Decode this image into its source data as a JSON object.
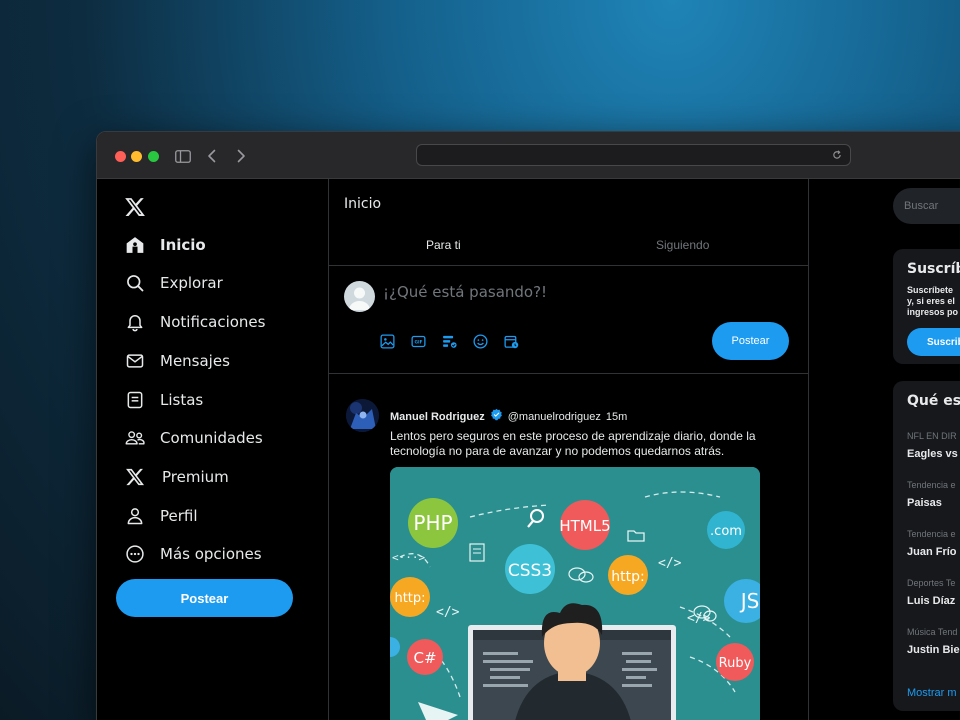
{
  "sidebar": {
    "items": [
      {
        "label": "Inicio",
        "icon": "home-icon"
      },
      {
        "label": "Explorar",
        "icon": "search-icon"
      },
      {
        "label": "Notificaciones",
        "icon": "bell-icon"
      },
      {
        "label": "Mensajes",
        "icon": "envelope-icon"
      },
      {
        "label": "Listas",
        "icon": "list-icon"
      },
      {
        "label": "Comunidades",
        "icon": "people-icon"
      },
      {
        "label": "Premium",
        "icon": "x-logo-icon"
      },
      {
        "label": "Perfil",
        "icon": "person-icon"
      },
      {
        "label": "Más opciones",
        "icon": "more-icon"
      }
    ],
    "post_label": "Postear"
  },
  "feed": {
    "title": "Inicio",
    "tabs": [
      "Para ti",
      "Siguiendo"
    ],
    "compose": {
      "placeholder": "¡¿Qué está pasando?!",
      "post_label": "Postear"
    },
    "tweet": {
      "name": "Manuel Rodriguez",
      "handle": "@manuelrodriguez",
      "time": "15m",
      "text": "Lentos pero seguros en este proceso de aprendizaje diario, donde la tecnología no para de avanzar y no podemos quedarnos atrás.",
      "image_labels": [
        "PHP",
        "HTML5",
        ".com",
        "CSS3",
        "http:",
        "http:",
        "JS",
        "C#",
        "Ruby",
        "<···>",
        "</>",
        "</>",
        "</>"
      ]
    }
  },
  "right": {
    "search_placeholder": "Buscar",
    "subscribe": {
      "title": "Suscríbe",
      "desc": "Suscríbete\ny, si eres el\ningresos po",
      "button": "Suscrib"
    },
    "trends_title": "Qué est",
    "trends": [
      {
        "category": "NFL EN DIR",
        "name": "Eagles vs C"
      },
      {
        "category": "Tendencia e",
        "name": "Paisas"
      },
      {
        "category": "Tendencia e",
        "name": "Juan Frío"
      },
      {
        "category": "Deportes Te",
        "name": "Luis Díaz"
      },
      {
        "category": "Música Tend",
        "name": "Justin Biel"
      }
    ],
    "show_more": "Mostrar m"
  },
  "colors": {
    "accent": "#1d9bf0",
    "background": "#000000",
    "card": "#16181c",
    "text": "#e7e9ea",
    "muted": "#71767b"
  }
}
